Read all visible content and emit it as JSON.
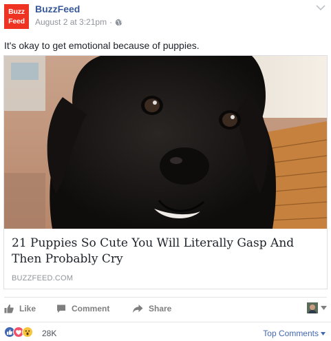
{
  "header": {
    "logo_line1": "Buzz",
    "logo_line2": "Feed",
    "page_name": "BuzzFeed",
    "timestamp": "August 2 at 3:21pm",
    "separator": "·",
    "privacy_icon": "globe-icon",
    "menu_icon": "chevron-down-icon"
  },
  "post": {
    "text": "It's okay to get emotional because of puppies."
  },
  "link_card": {
    "image_subject": "puppy-photo",
    "title": "21 Puppies So Cute You Will Literally Gasp And Then Probably Cry",
    "domain": "BUZZFEED.COM"
  },
  "actions": {
    "like_label": "Like",
    "comment_label": "Comment",
    "share_label": "Share",
    "like_icon": "thumbs-up-icon",
    "comment_icon": "speech-bubble-icon",
    "share_icon": "share-arrow-icon",
    "avatar_selector_icon": "caret-down-icon"
  },
  "footer": {
    "reactions": [
      "like",
      "love",
      "wow"
    ],
    "reaction_count": "28K",
    "sort_label": "Top Comments",
    "sort_icon": "caret-down-icon"
  },
  "colors": {
    "brand_red": "#ee3322",
    "link_blue": "#365899",
    "meta_gray": "#90949c",
    "like_blue": "#4267b2",
    "love_red": "#f25268",
    "wow_yellow": "#f7c53f"
  }
}
